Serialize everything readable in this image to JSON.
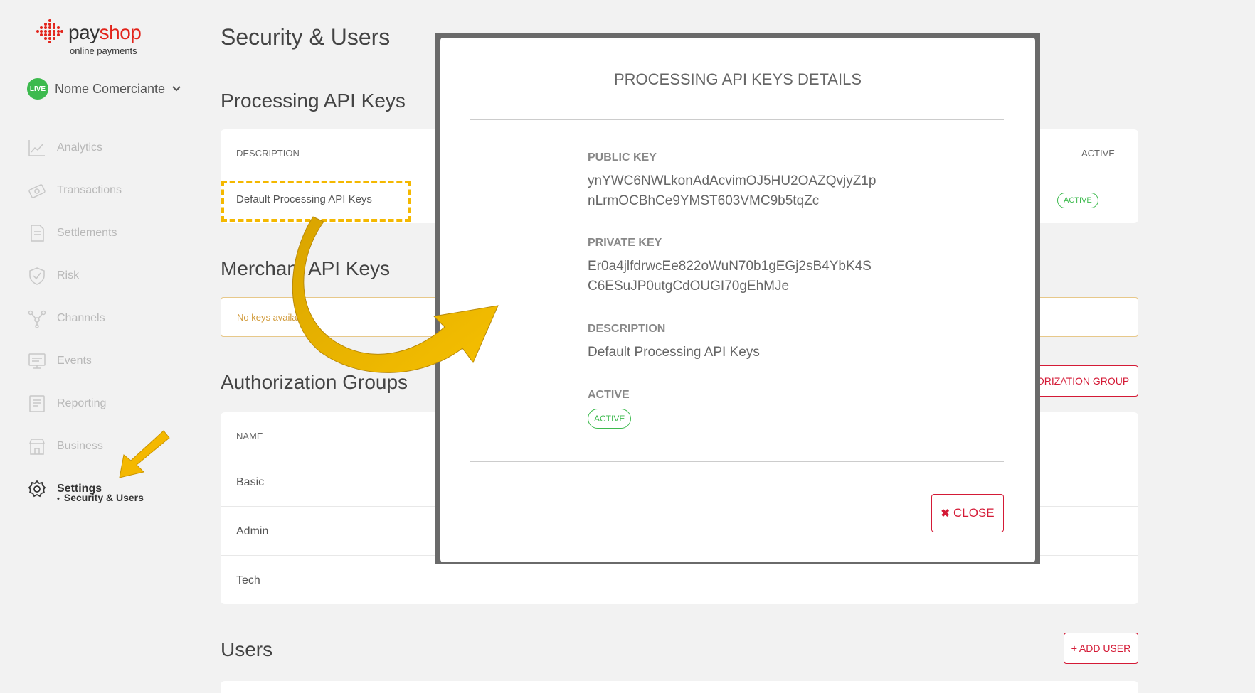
{
  "brand": {
    "name_pre": "pay",
    "name_post": "shop",
    "tagline": "online payments"
  },
  "merchant": {
    "badge": "LIVE",
    "name": "Nome Comerciante"
  },
  "sidebar": {
    "items": [
      {
        "label": "Analytics",
        "icon": "analytics-icon"
      },
      {
        "label": "Transactions",
        "icon": "transactions-icon"
      },
      {
        "label": "Settlements",
        "icon": "settlements-icon"
      },
      {
        "label": "Risk",
        "icon": "shield-icon"
      },
      {
        "label": "Channels",
        "icon": "channels-icon"
      },
      {
        "label": "Events",
        "icon": "events-icon"
      },
      {
        "label": "Reporting",
        "icon": "reporting-icon"
      },
      {
        "label": "Business",
        "icon": "store-icon"
      },
      {
        "label": "Settings",
        "icon": "gear-icon"
      }
    ],
    "sub_item": "Security & Users"
  },
  "page": {
    "title": "Security & Users",
    "processing": {
      "heading": "Processing API Keys",
      "col_description": "DESCRIPTION",
      "col_active": "ACTIVE",
      "row_description": "Default Processing API Keys",
      "row_status": "ACTIVE"
    },
    "merchant_keys": {
      "heading": "Merchant API Keys",
      "empty": "No keys available"
    },
    "auth_groups": {
      "heading": "Authorization Groups",
      "add_button": "+ ADD AUTHORIZATION GROUP",
      "col_name": "NAME",
      "rows": [
        "Basic",
        "Admin",
        "Tech"
      ]
    },
    "users": {
      "heading": "Users",
      "add_button": "ADD USER"
    }
  },
  "modal": {
    "title": "PROCESSING API KEYS DETAILS",
    "public_key_label": "PUBLIC KEY",
    "public_key_line1": "ynYWC6NWLkonAdAcvimOJ5HU2OAZQvjyZ1p",
    "public_key_line2": "nLrmOCBhCe9YMST603VMC9b5tqZc",
    "private_key_label": "PRIVATE KEY",
    "private_key_line1": "Er0a4jlfdrwcEe822oWuN70b1gEGj2sB4YbK4S",
    "private_key_line2": "C6ESuJP0utgCdOUGI70gEhMJe",
    "description_label": "DESCRIPTION",
    "description_value": "Default Processing API Keys",
    "active_label": "ACTIVE",
    "active_value": "ACTIVE",
    "close_label": "CLOSE"
  },
  "colors": {
    "accent_red": "#d41a36",
    "live_green": "#3dba4e",
    "highlight_yellow": "#f4b800"
  }
}
